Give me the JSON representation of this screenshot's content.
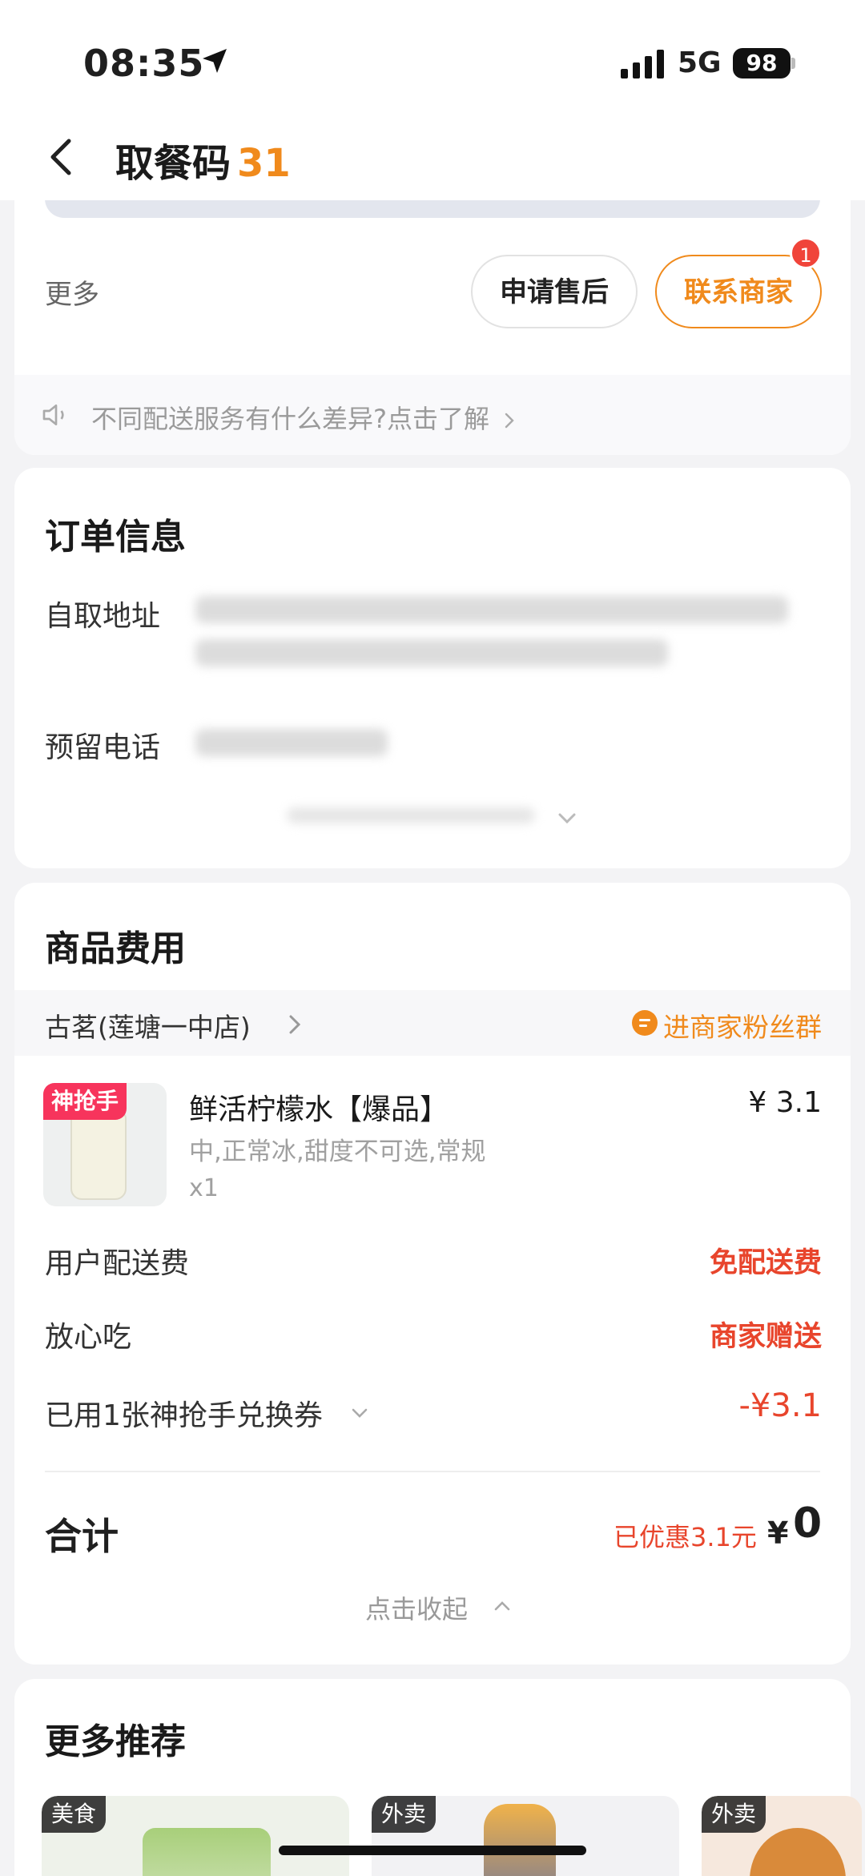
{
  "status_bar": {
    "time": "08:35",
    "network": "5G",
    "battery": "98"
  },
  "header": {
    "title": "取餐码",
    "code": "31"
  },
  "actions": {
    "more_label": "更多",
    "after_sale": "申请售后",
    "contact_merchant": "联系商家",
    "contact_badge": "1",
    "notice": "不同配送服务有什么差异?点击了解"
  },
  "order_info": {
    "title": "订单信息",
    "pickup_address_label": "自取地址",
    "phone_label": "预留电话"
  },
  "goods": {
    "title": "商品费用",
    "shop_name": "古茗(莲塘一中店)",
    "fans_group": "进商家粉丝群",
    "item": {
      "tag": "神抢手",
      "name": "鲜活柠檬水【爆品】",
      "spec": "中,正常冰,甜度不可选,常规",
      "qty": "x1",
      "price": "¥ 3.1"
    },
    "delivery_fee_label": "用户配送费",
    "delivery_fee_value": "免配送费",
    "assurance_label": "放心吃",
    "assurance_value": "商家赠送",
    "coupon_label": "已用1张神抢手兑换券",
    "coupon_value": "-¥3.1",
    "total_label": "合计",
    "saved": "已优惠3.1元",
    "total_symbol": "¥",
    "total_value": "0",
    "collapse": "点击收起"
  },
  "recommend": {
    "title": "更多推荐",
    "tiles": [
      {
        "tag": "美食"
      },
      {
        "tag": "外卖"
      },
      {
        "tag": "外卖"
      }
    ]
  },
  "colors": {
    "accent_orange": "#f08a1c",
    "price_red": "#e8452c",
    "tag_pink": "#f7345c"
  }
}
